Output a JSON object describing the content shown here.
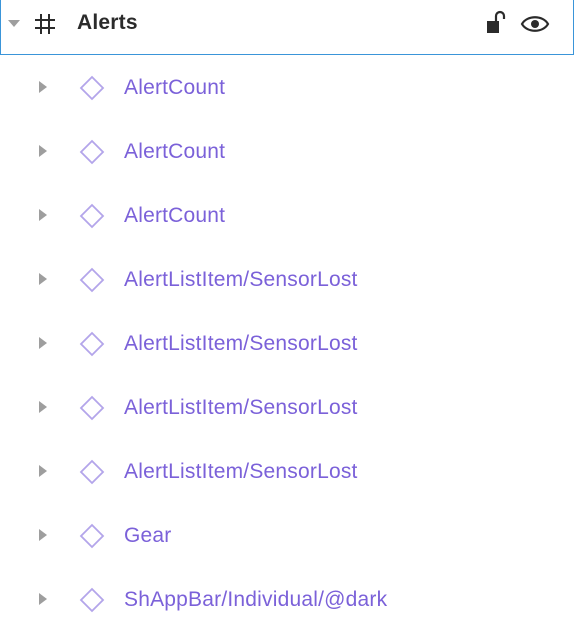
{
  "frame": {
    "title": "Alerts",
    "icon": "hash-frame-icon",
    "lock_icon": "unlocked-padlock-icon",
    "visibility_icon": "eye-icon",
    "selection_color": "#3a95d9"
  },
  "layers": [
    {
      "label": "AlertCount",
      "icon": "component-diamond-icon"
    },
    {
      "label": "AlertCount",
      "icon": "component-diamond-icon"
    },
    {
      "label": "AlertCount",
      "icon": "component-diamond-icon"
    },
    {
      "label": "AlertListItem/SensorLost",
      "icon": "component-diamond-icon"
    },
    {
      "label": "AlertListItem/SensorLost",
      "icon": "component-diamond-icon"
    },
    {
      "label": "AlertListItem/SensorLost",
      "icon": "component-diamond-icon"
    },
    {
      "label": "AlertListItem/SensorLost",
      "icon": "component-diamond-icon"
    },
    {
      "label": "Gear",
      "icon": "component-diamond-icon"
    },
    {
      "label": "ShAppBar/Individual/@dark",
      "icon": "component-diamond-icon"
    }
  ],
  "colors": {
    "component_text": "#7b61d9",
    "component_icon": "#b3a5ea",
    "caret": "#9e9e9e",
    "frame_text": "#2b2b2b"
  }
}
